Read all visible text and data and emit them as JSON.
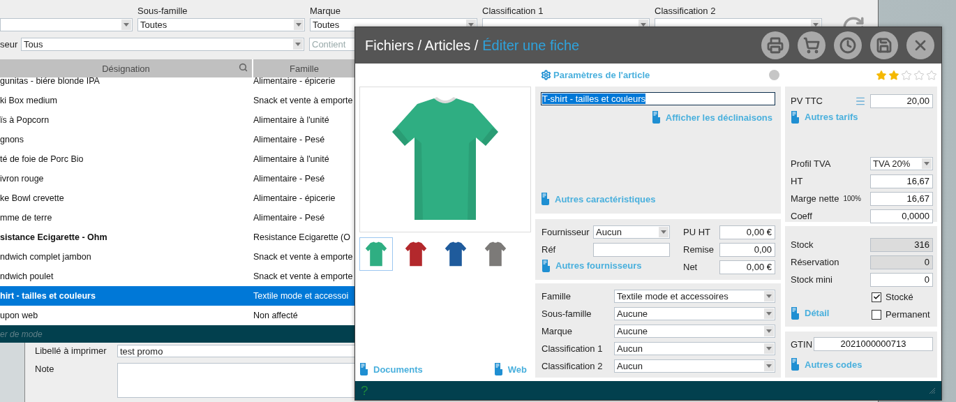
{
  "background": {
    "filters": [
      {
        "kind": "select"
      },
      {
        "kind": "select",
        "label": "Sous-famille",
        "value": "Toutes"
      },
      {
        "kind": "select",
        "label": "Marque",
        "value": "Toutes"
      },
      {
        "kind": "select",
        "label": "Classification 1"
      },
      {
        "kind": "select",
        "label": "Classification 2"
      }
    ],
    "filter_row_2": {
      "label": "seur",
      "value": "Tous",
      "search_placeholder": "Contient"
    },
    "table": {
      "columns": [
        "Désignation",
        "Famille"
      ],
      "rows": [
        {
          "designation": "gunitas - biére blonde IPA",
          "famille": "Alimentaire - épicerie",
          "bold": false,
          "selected": false
        },
        {
          "designation": "ki Box medium",
          "famille": "Snack et vente à emporte",
          "bold": false,
          "selected": false
        },
        {
          "designation": "ïs à Popcorn",
          "famille": "Alimentaire à l'unité",
          "bold": false,
          "selected": false
        },
        {
          "designation": "gnons",
          "famille": "Alimentaire - Pesé",
          "bold": false,
          "selected": false
        },
        {
          "designation": "té de foie de Porc Bio",
          "famille": "Alimentaire à l'unité",
          "bold": false,
          "selected": false
        },
        {
          "designation": "ivron rouge",
          "famille": "Alimentaire - Pesé",
          "bold": false,
          "selected": false
        },
        {
          "designation": "ke Bowl crevette",
          "famille": "Alimentaire - épicerie",
          "bold": false,
          "selected": false
        },
        {
          "designation": "mme de terre",
          "famille": "Alimentaire - Pesé",
          "bold": false,
          "selected": false
        },
        {
          "designation": "sistance Ecigarette - Ohm",
          "famille": "Resistance Ecigarette (O",
          "bold": true,
          "selected": false
        },
        {
          "designation": "ndwich complet jambon",
          "famille": "Snack et vente à emporte",
          "bold": false,
          "selected": false
        },
        {
          "designation": "ndwich poulet",
          "famille": "Snack et vente à emporte",
          "bold": false,
          "selected": false
        },
        {
          "designation": "hirt - tailles et couleurs",
          "famille": "Textile mode et accessoi",
          "bold": true,
          "selected": true
        },
        {
          "designation": "upon web",
          "famille": "Non affecté",
          "bold": false,
          "selected": false
        }
      ]
    },
    "status_bar": "er de mode",
    "form": [
      {
        "kind": "input",
        "label": "Libellé à imprimer",
        "value": "test promo"
      },
      {
        "kind": "textarea",
        "label": "Note"
      }
    ]
  },
  "dialog": {
    "title": "Fichiers / Articles /",
    "current": "Éditer une fiche",
    "images": [
      {
        "color": "#2fae82",
        "selected": true
      },
      {
        "color": "#b3282c",
        "selected": false
      },
      {
        "color": "#1f5b9c",
        "selected": false
      },
      {
        "color": "#7c7a78",
        "selected": false
      }
    ],
    "links_left": [
      "Documents",
      "Web"
    ],
    "section_title": "Paramètres de l'article",
    "name": {
      "value": "T-shirt - tailles et couleurs",
      "text_selected": true
    },
    "variants_link": "Afficher les déclinaisons",
    "features_link": "Autres caractéristiques",
    "supplier": {
      "fields": [
        {
          "kind": "select",
          "label": "Fournisseur",
          "value": "Aucun"
        },
        {
          "kind": "input",
          "label": "Réf"
        }
      ],
      "link": "Autres fournisseurs",
      "prices": [
        {
          "label": "PU HT",
          "value": "0,00 €"
        },
        {
          "label": "Remise",
          "value": "0,00"
        },
        {
          "label": "Net",
          "value": "0,00 €"
        }
      ]
    },
    "classification": [
      {
        "label": "Famille",
        "value": "Textile mode et accessoires"
      },
      {
        "label": "Sous-famille",
        "value": "Aucune"
      },
      {
        "label": "Marque",
        "value": "Aucune"
      },
      {
        "label": "Classification 1",
        "value": "Aucun"
      },
      {
        "label": "Classification 2",
        "value": "Aucun"
      }
    ],
    "stars": 2,
    "pricing": {
      "pv_ttc": {
        "label": "PV TTC",
        "value": "20,00"
      },
      "link": "Autres tarifs",
      "fields": [
        {
          "kind": "select",
          "label": "Profil TVA",
          "value": "TVA 20%"
        },
        {
          "kind": "input",
          "label": "HT",
          "value": "16,67"
        },
        {
          "kind": "input",
          "label": "Marge nette",
          "note": "100%",
          "value": "16,67"
        },
        {
          "kind": "input",
          "label": "Coeff",
          "value": "0,0000"
        }
      ]
    },
    "stock": {
      "fields": [
        {
          "label": "Stock",
          "value": "316",
          "readonly": true
        },
        {
          "label": "Réservation",
          "value": "0",
          "readonly": true
        },
        {
          "label": "Stock mini",
          "value": "0",
          "readonly": false
        }
      ],
      "checkboxes": [
        {
          "label": "Stocké",
          "checked": true
        },
        {
          "label": "Permanent",
          "checked": false
        }
      ],
      "link": "Détail"
    },
    "codes": {
      "label": "GTIN",
      "value": "2021000000713",
      "link": "Autres codes"
    },
    "footer": "?"
  }
}
